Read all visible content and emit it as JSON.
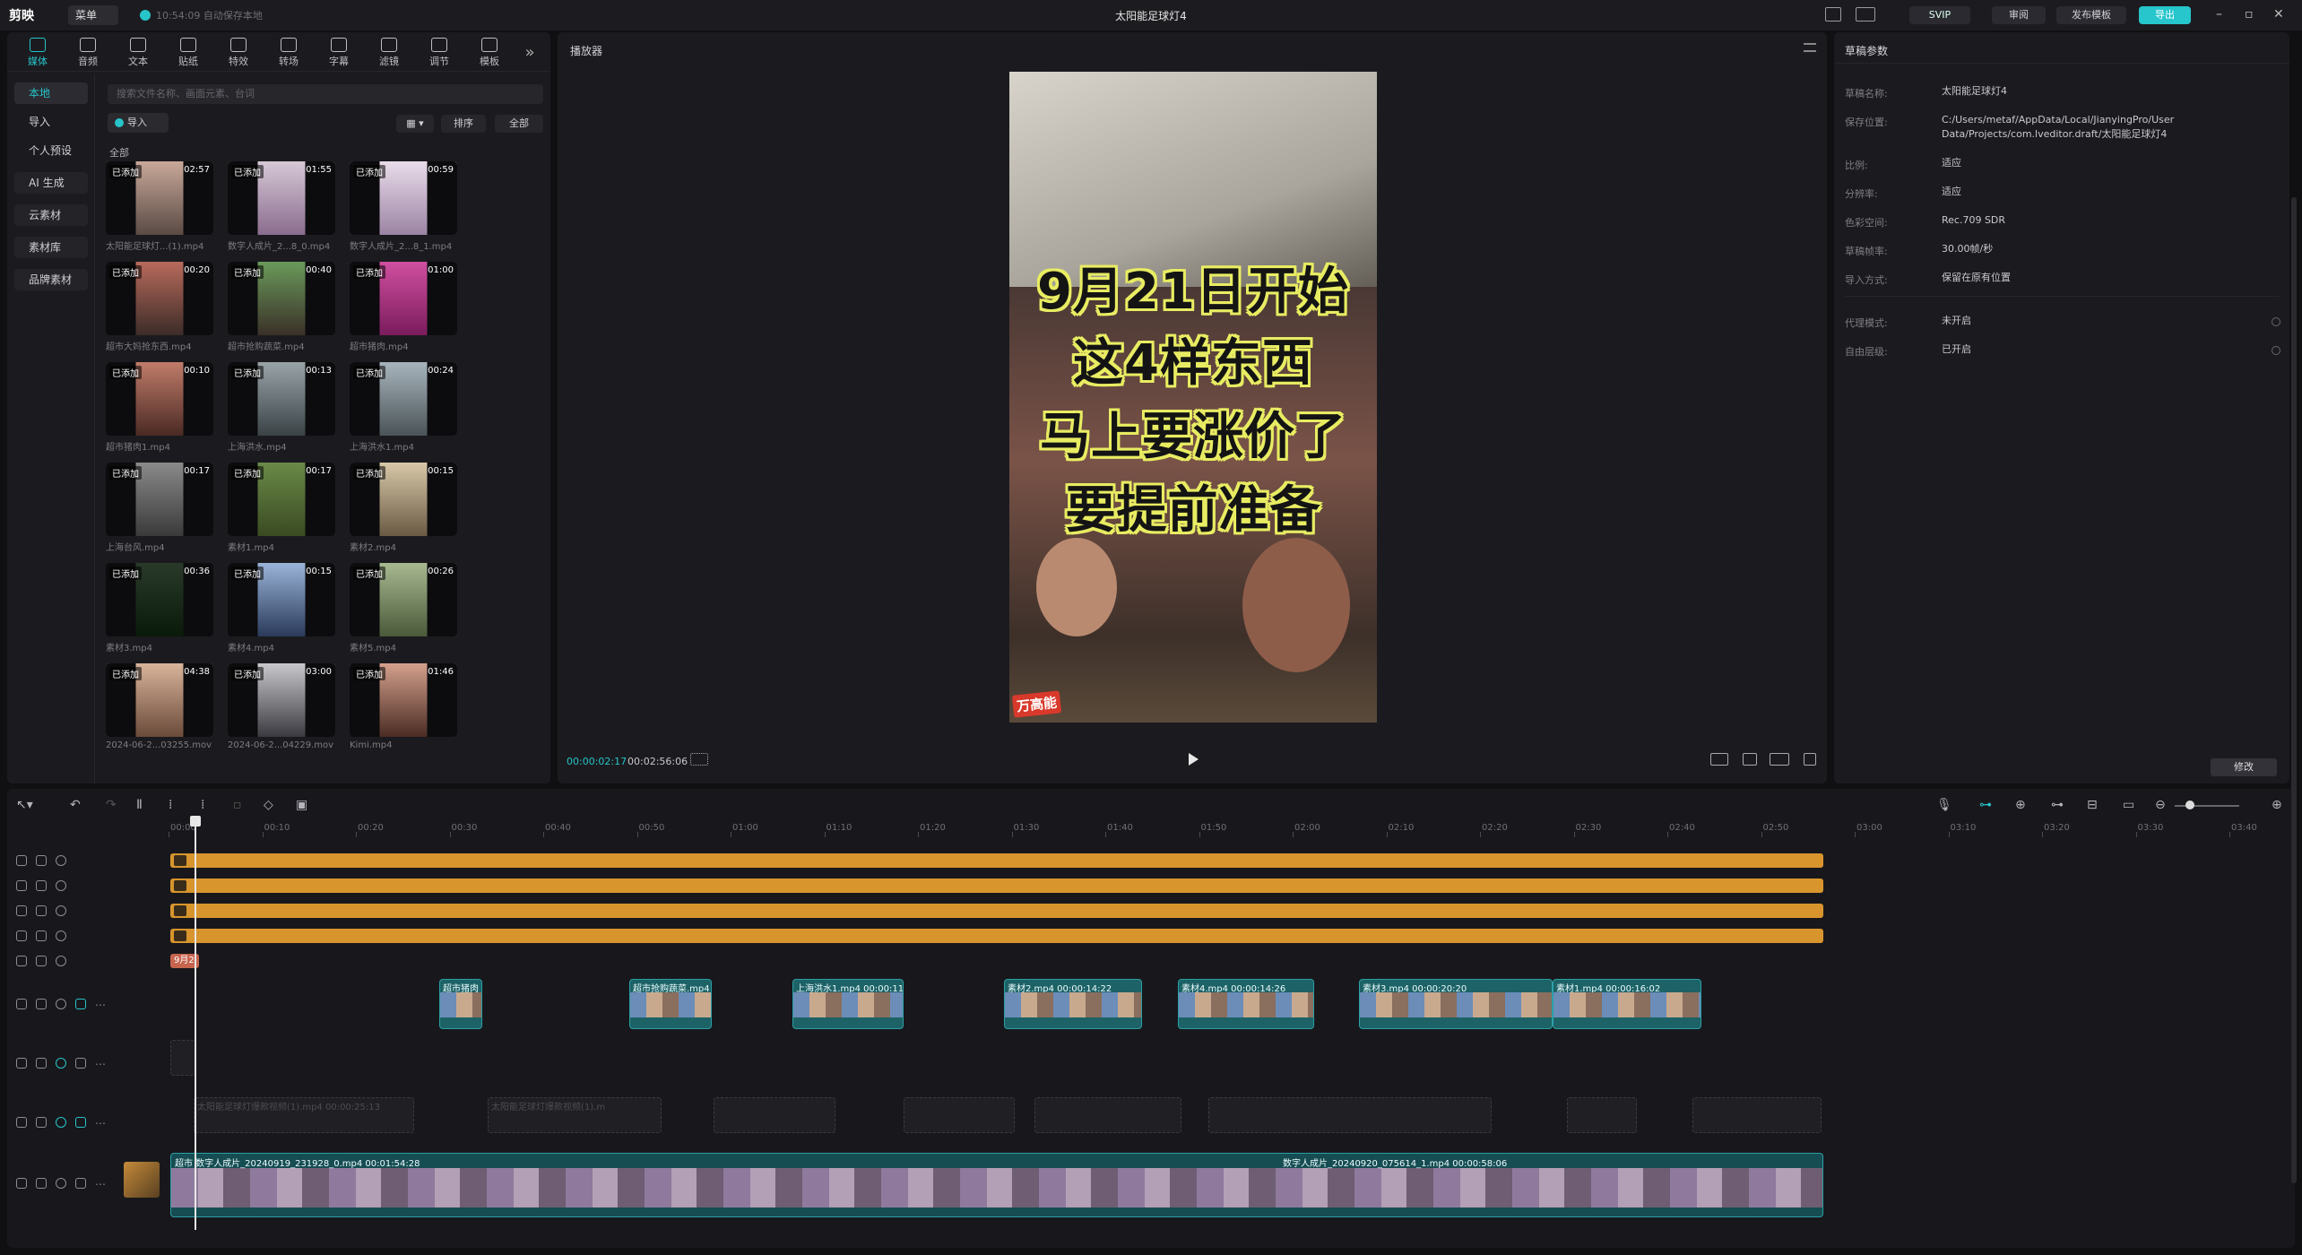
{
  "app": {
    "logo": "剪映",
    "menu_label": "菜单",
    "autosave": "10:54:09 自动保存本地",
    "project_title": "太阳能足球灯4"
  },
  "titlebar": {
    "svip": "SVIP",
    "review": "审阅",
    "publish": "发布模板",
    "export": "导出"
  },
  "toolbar": {
    "items": [
      "媒体",
      "音频",
      "文本",
      "贴纸",
      "特效",
      "转场",
      "字幕",
      "滤镜",
      "调节",
      "模板"
    ]
  },
  "sidebar": {
    "items": [
      "本地",
      "导入",
      "个人预设",
      "AI 生成",
      "云素材",
      "素材库",
      "品牌素材"
    ]
  },
  "library": {
    "search_placeholder": "搜索文件名称、画面元素、台词",
    "import_label": "导入",
    "sort_label": "排序",
    "filter_label": "全部",
    "all_label": "全部",
    "added_badge": "已添加",
    "cards": [
      {
        "name": "太阳能足球灯...(1).mp4",
        "duration": "02:57"
      },
      {
        "name": "数字人成片_2...8_0.mp4",
        "duration": "01:55"
      },
      {
        "name": "数字人成片_2...8_1.mp4",
        "duration": "00:59"
      },
      {
        "name": "超市大妈抢东西.mp4",
        "duration": "00:20"
      },
      {
        "name": "超市抢购蔬菜.mp4",
        "duration": "00:40"
      },
      {
        "name": "超市猪肉.mp4",
        "duration": "01:00"
      },
      {
        "name": "超市猪肉1.mp4",
        "duration": "00:10"
      },
      {
        "name": "上海洪水.mp4",
        "duration": "00:13"
      },
      {
        "name": "上海洪水1.mp4",
        "duration": "00:24"
      },
      {
        "name": "上海台风.mp4",
        "duration": "00:17"
      },
      {
        "name": "素材1.mp4",
        "duration": "00:17"
      },
      {
        "name": "素材2.mp4",
        "duration": "00:15"
      },
      {
        "name": "素材3.mp4",
        "duration": "00:36"
      },
      {
        "name": "素材4.mp4",
        "duration": "00:15"
      },
      {
        "name": "素材5.mp4",
        "duration": "00:26"
      },
      {
        "name": "2024-06-2...03255.mov",
        "duration": "04:38"
      },
      {
        "name": "2024-06-2...04229.mov",
        "duration": "03:00"
      },
      {
        "name": "Kimi.mp4",
        "duration": "01:46"
      }
    ]
  },
  "player": {
    "label": "播放器",
    "caption_lines": [
      "9月21日开始",
      "这4样东西",
      "马上要涨价了",
      "要提前准备"
    ],
    "watermark": "万高能",
    "current_time": "00:00:02:17",
    "total_time": "00:02:56:06"
  },
  "props": {
    "title": "草稿参数",
    "rows": [
      {
        "k": "草稿名称:",
        "v": "太阳能足球灯4"
      },
      {
        "k": "保存位置:",
        "v": "C:/Users/metaf/AppData/Local/JianyingPro/User Data/Projects/com.lveditor.draft/太阳能足球灯4"
      },
      {
        "k": "比例:",
        "v": "适应"
      },
      {
        "k": "分辨率:",
        "v": "适应"
      },
      {
        "k": "色彩空间:",
        "v": "Rec.709 SDR"
      },
      {
        "k": "草稿帧率:",
        "v": "30.00帧/秒"
      },
      {
        "k": "导入方式:",
        "v": "保留在原有位置"
      },
      {
        "k": "代理模式:",
        "v": "未开启"
      },
      {
        "k": "自由层级:",
        "v": "已开启"
      }
    ],
    "edit_label": "修改"
  },
  "timeline": {
    "ticks": [
      "00:00",
      "00:10",
      "00:20",
      "00:30",
      "00:40",
      "00:50",
      "01:00",
      "01:10",
      "01:20",
      "01:30",
      "01:40",
      "01:50",
      "02:00",
      "02:10",
      "02:20",
      "02:30",
      "02:40",
      "02:50",
      "03:00",
      "03:10",
      "03:20",
      "03:30",
      "03:40"
    ],
    "text_clip": "9月2",
    "clips": [
      {
        "label": "超市猪肉"
      },
      {
        "label": "超市抢购蔬菜.mp4  0"
      },
      {
        "label": "上海洪水1.mp4  00:00:11"
      },
      {
        "label": "素材2.mp4  00:00:14:22"
      },
      {
        "label": "素材4.mp4  00:00:14:26"
      },
      {
        "label": "素材3.mp4  00:00:20:20"
      },
      {
        "label": "素材1.mp4  00:00:16:02"
      }
    ],
    "main_clips": [
      {
        "label": "超市  数字人成片_20240919_231928_0.mp4  00:01:54:28"
      },
      {
        "label": "数字人成片_20240920_075614_1.mp4  00:00:58:06"
      }
    ],
    "ghost_label": "太阳能足球灯爆款视频(1).mp4  00:00:25:13",
    "ghost_label_short": "太阳能足球灯爆款视频(1).m"
  }
}
